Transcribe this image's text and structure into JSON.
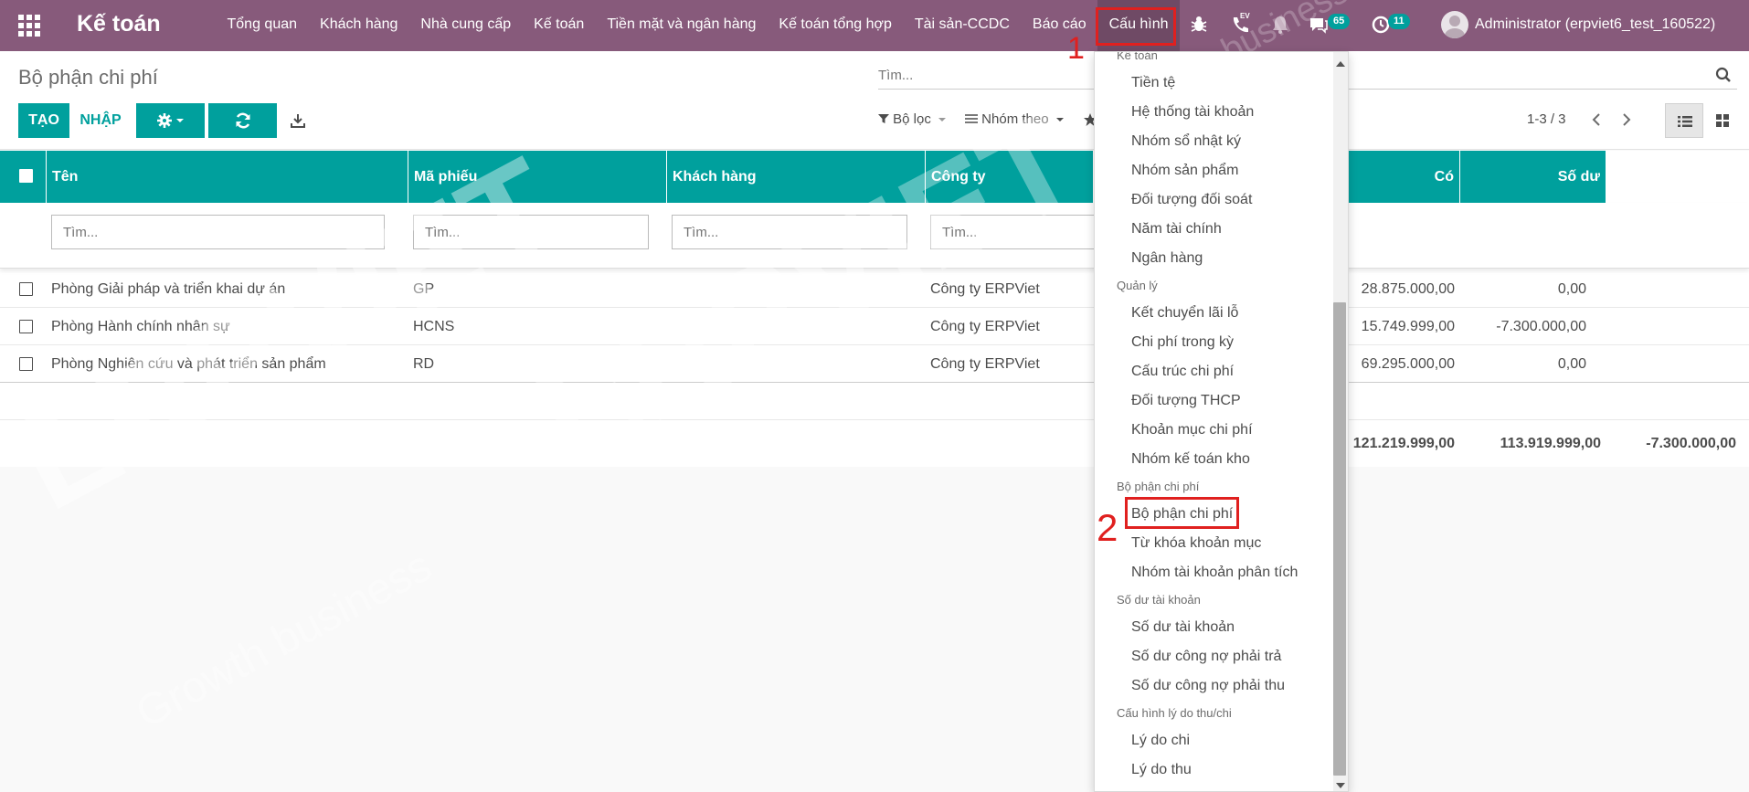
{
  "navbar": {
    "app_name": "Kế toán",
    "menu": [
      "Tổng quan",
      "Khách hàng",
      "Nhà cung cấp",
      "Kế toán",
      "Tiền mặt và ngân hàng",
      "Kế toán tổng hợp",
      "Tài sản-CCDC",
      "Báo cáo",
      "Cấu hình"
    ],
    "active_menu": "Cấu hình",
    "ev_label": "EV",
    "messages_count": "65",
    "activities_count": "11",
    "user": "Administrator (erpviet6_test_160522)"
  },
  "control": {
    "breadcrumb": "Bộ phận chi phí",
    "search_placeholder": "Tìm...",
    "create_label": "TẠO",
    "import_label": "NHẬP",
    "filter_label": "Bộ lọc",
    "groupby_label": "Nhóm theo",
    "pager": "1-3 / 3"
  },
  "table": {
    "columns": [
      "Tên",
      "Mã phiếu",
      "Khách hàng",
      "Công ty",
      "Có",
      "Số dư"
    ],
    "filter_placeholder": "Tìm...",
    "rows": [
      {
        "name": "Phòng Giải pháp và triển khai dự án",
        "code": "GP",
        "customer": "",
        "company": "Công ty ERPViet",
        "debit": "28.875.000,00",
        "balance": "0,00"
      },
      {
        "name": "Phòng Hành chính nhân sự",
        "code": "HCNS",
        "customer": "",
        "company": "Công ty ERPViet",
        "debit": "15.749.999,00",
        "balance": "-7.300.000,00"
      },
      {
        "name": "Phòng Nghiên cứu và phát triển sản phẩm",
        "code": "RD",
        "customer": "",
        "company": "Công ty ERPViet",
        "debit": "69.295.000,00",
        "balance": "0,00"
      }
    ],
    "totals": {
      "col1": "121.219.999,00",
      "col2": "113.919.999,00",
      "col3": "-7.300.000,00"
    }
  },
  "dropdown": {
    "sections": [
      {
        "header": "Kế toán",
        "items": [
          "Tiền tệ",
          "Hệ thống tài khoản",
          "Nhóm sổ nhật ký",
          "Nhóm sản phẩm",
          "Đối tượng đối soát",
          "Năm tài chính",
          "Ngân hàng"
        ]
      },
      {
        "header": "Quản lý",
        "items": [
          "Kết chuyển lãi lỗ",
          "Chi phí trong kỳ",
          "Cấu trúc chi phí",
          "Đối tượng THCP",
          "Khoản mục chi phí",
          "Nhóm kế toán kho"
        ]
      },
      {
        "header": "Bộ phận chi phí",
        "items": [
          "Bộ phận chi phí",
          "Từ khóa khoản mục",
          "Nhóm tài khoản phân tích"
        ]
      },
      {
        "header": "Số dư tài khoản",
        "items": [
          "Số dư tài khoản",
          "Số dư công nợ phải trả",
          "Số dư công nợ phải thu"
        ]
      },
      {
        "header": "Cấu hình lý do thu/chi",
        "items": [
          "Lý do chi",
          "Lý do thu"
        ]
      }
    ]
  },
  "annotations": {
    "step1": "1",
    "step2": "2"
  },
  "watermark": {
    "brand": "ERPVIET",
    "tagline": "Growth business",
    "tagline_short": "business"
  },
  "colors": {
    "navbar": "#875a7b",
    "accent": "#00a09d",
    "highlight": "#e0201f"
  }
}
